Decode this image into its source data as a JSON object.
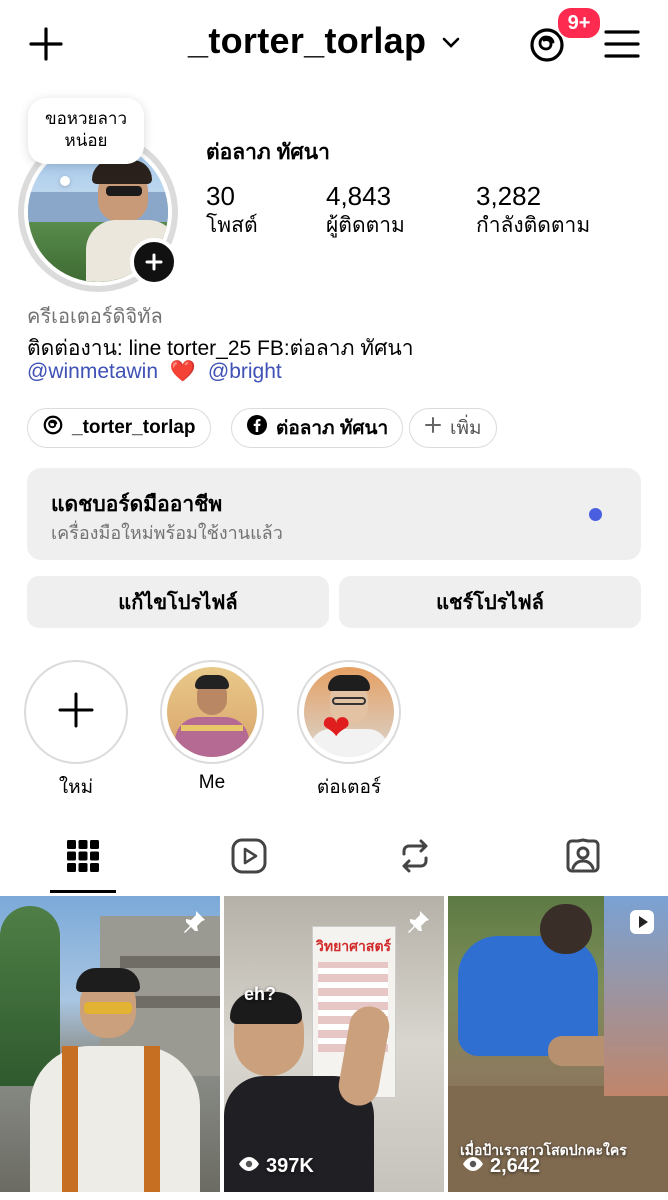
{
  "header": {
    "username": "_torter_torlap",
    "notification_count": "9+"
  },
  "profile": {
    "note": "ขอหวยลาว หน่อย",
    "full_name": "ต่อลาภ ทัศนา",
    "stats": [
      {
        "value": "30",
        "label": "โพสต์"
      },
      {
        "value": "4,843",
        "label": "ผู้ติดตาม"
      },
      {
        "value": "3,282",
        "label": "กำลังติดตาม"
      }
    ],
    "category": "ครีเอเตอร์ดิจิทัล",
    "bio": "ติดต่องาน: line torter_25 FB:ต่อลาภ ทัศนา",
    "mention_1": "@winmetawin",
    "heart": "❤️",
    "mention_2": "@bright"
  },
  "chips": {
    "threads": "_torter_torlap",
    "facebook": "ต่อลาภ ทัศนา",
    "add": "เพิ่ม"
  },
  "dashboard": {
    "title": "แดชบอร์ดมืออาชีพ",
    "subtitle": "เครื่องมือใหม่พร้อมใช้งานแล้ว"
  },
  "buttons": {
    "edit": "แก้ไขโปรไฟล์",
    "share": "แชร์โปรไฟล์"
  },
  "highlights": [
    {
      "label": "ใหม่"
    },
    {
      "label": "Me"
    },
    {
      "label": "ต่อเตอร์"
    }
  ],
  "posts": [
    {
      "views": "",
      "pinned": true
    },
    {
      "views": "397K",
      "pinned": true,
      "caption": "eh?",
      "poster_text": "วิทยาศาสตร์"
    },
    {
      "views": "2,642",
      "pinned": false,
      "caption": "เมื่อป้าเราสาวโสดปกคะใคร"
    }
  ],
  "colors": {
    "badge": "#ff2a4f",
    "link": "#3f51b5",
    "dashboard_dot": "#4a5fe0"
  }
}
